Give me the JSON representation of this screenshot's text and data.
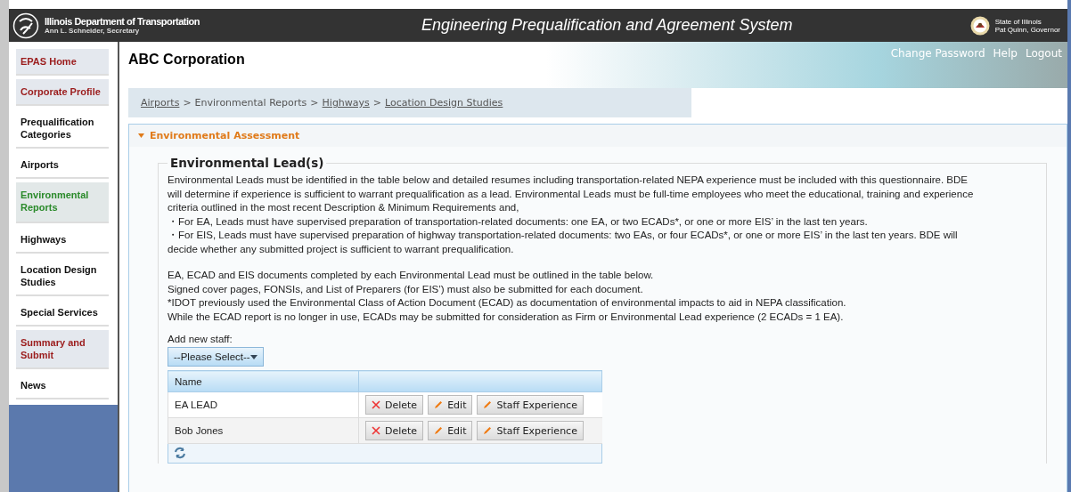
{
  "header": {
    "agency": "Illinois Department of Transportation",
    "secretary": "Ann L. Schneider, Secretary",
    "title": "Engineering Prequalification and Agreement System",
    "state": "State of Illinois",
    "governor": "Pat Quinn, Governor"
  },
  "top_links": [
    "Change Password",
    "Help",
    "Logout"
  ],
  "sidebar": {
    "items": [
      {
        "label": "EPAS Home",
        "kind": "action",
        "selected": false
      },
      {
        "label": "Corporate Profile",
        "kind": "action",
        "selected": false
      },
      {
        "label": "Prequalification Categories",
        "kind": "category",
        "selected": false
      },
      {
        "label": "Airports",
        "kind": "category",
        "selected": false
      },
      {
        "label": "Environmental Reports",
        "kind": "category",
        "selected": true
      },
      {
        "label": "Highways",
        "kind": "category",
        "selected": false
      },
      {
        "label": "Location Design Studies",
        "kind": "category",
        "selected": false
      },
      {
        "label": "Special Services",
        "kind": "category",
        "selected": false
      },
      {
        "label": "Summary and Submit",
        "kind": "action",
        "selected": false
      },
      {
        "label": "News",
        "kind": "category",
        "selected": false
      }
    ]
  },
  "company": "ABC Corporation",
  "breadcrumb_separator": ">",
  "breadcrumb": [
    {
      "label": "Airports",
      "link": true
    },
    {
      "label": "Environmental Reports",
      "link": false
    },
    {
      "label": "Highways",
      "link": true
    },
    {
      "label": "Location Design Studies",
      "link": true
    }
  ],
  "panel": {
    "title": "Environmental Assessment",
    "expanded": true,
    "fieldset": "Environmental Lead(s)",
    "blocks": [
      [
        "Environmental Leads must be identified in the table below and detailed resumes including transportation-related NEPA experience must be included with this questionnaire. BDE",
        "will determine if experience is sufficient to warrant prequalification as a lead. Environmental Leads must be full-time employees who meet the educational, training and experience",
        "criteria outlined in the most recent Description & Minimum Requirements and,",
        "・For EA, Leads must have supervised preparation of transportation-related documents: one EA, or two ECADs*, or one or more EIS’ in the last ten years.",
        "・For EIS, Leads must have supervised preparation of highway transportation-related documents: two EAs, or four ECADs*, or one or more EIS’ in the last ten years. BDE will",
        "decide whether any submitted project is sufficient to warrant prequalification."
      ],
      [
        "EA, ECAD and EIS documents completed by each Environmental Lead must be outlined in the table below.",
        "Signed cover pages, FONSIs, and List of Preparers (for EIS’) must also be submitted for each document.",
        "*IDOT previously used the Environmental Class of Action Document (ECAD) as documentation of environmental impacts to aid in NEPA classification.",
        "While the ECAD report is no longer in use, ECADs may be submitted for consideration as Firm or Environmental Lead experience (2 ECADs = 1 EA)."
      ]
    ],
    "add_staff": {
      "label": "Add new staff:",
      "value": "--Please Select--"
    },
    "table": {
      "columns": [
        "Name"
      ],
      "rows": [
        {
          "name": "EA LEAD",
          "actions": [
            "Delete",
            "Edit",
            "Staff Experience"
          ]
        },
        {
          "name": "Bob Jones",
          "actions": [
            "Delete",
            "Edit",
            "Staff Experience"
          ]
        }
      ]
    }
  }
}
